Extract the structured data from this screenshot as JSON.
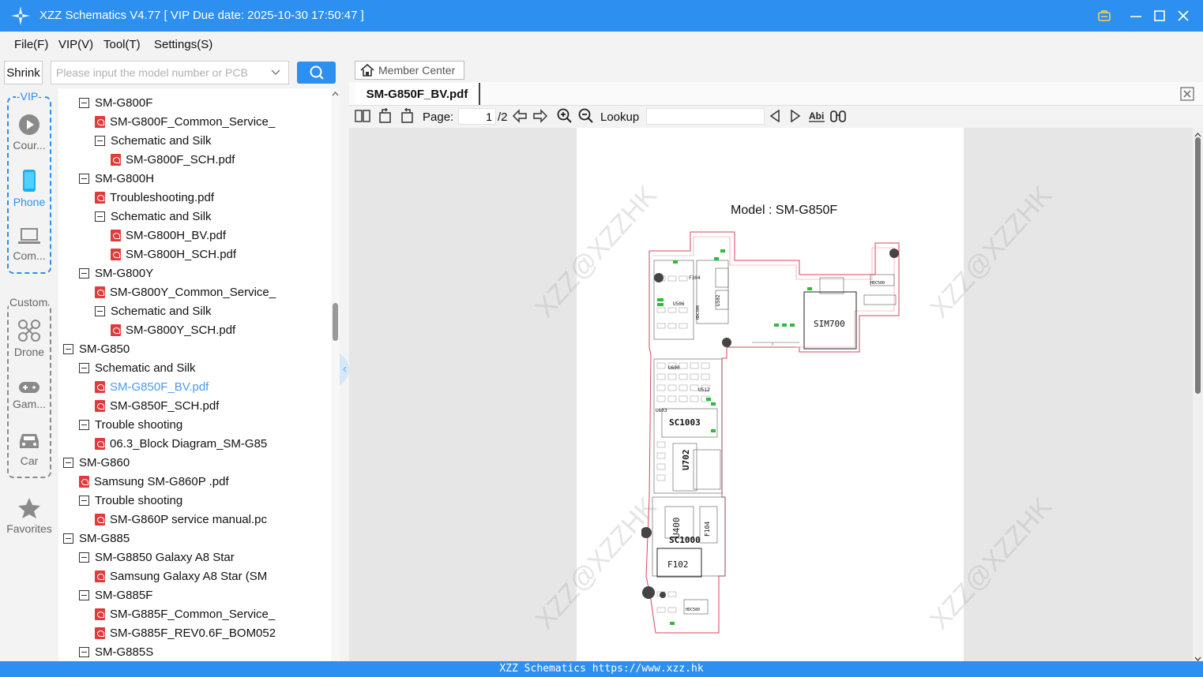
{
  "window": {
    "title": "XZZ Schematics V4.77 [ VIP Due date: 2025-10-30 17:50:47 ]"
  },
  "menu": [
    "File(F)",
    "VIP(V)",
    "Tool(T)",
    "Settings(S)"
  ],
  "search": {
    "shrink_label": "Shrink",
    "placeholder": "Please input the model number or PCB"
  },
  "rail": {
    "vip_label": "-VIP-",
    "vip_items": [
      {
        "label": "Cour...",
        "icon": "play-icon"
      },
      {
        "label": "Phone",
        "icon": "phone-icon"
      },
      {
        "label": "Com...",
        "icon": "laptop-icon"
      }
    ],
    "custom_label": "Custom",
    "custom_items": [
      {
        "label": "Drone",
        "icon": "drone-icon"
      },
      {
        "label": "Gam...",
        "icon": "gamepad-icon"
      },
      {
        "label": "Car",
        "icon": "car-icon"
      }
    ],
    "favorites_label": "Favorites"
  },
  "tree": [
    {
      "label": "SM-G800F",
      "type": "folder",
      "level": 2
    },
    {
      "label": "SM-G800F_Common_Service_",
      "type": "pdf",
      "level": 3
    },
    {
      "label": "Schematic and Silk",
      "type": "folder",
      "level": 3
    },
    {
      "label": "SM-G800F_SCH.pdf",
      "type": "pdf",
      "level": 4
    },
    {
      "label": "SM-G800H",
      "type": "folder",
      "level": 2
    },
    {
      "label": "Troubleshooting.pdf",
      "type": "pdf",
      "level": 3
    },
    {
      "label": "Schematic and Silk",
      "type": "folder",
      "level": 3
    },
    {
      "label": "SM-G800H_BV.pdf",
      "type": "pdf",
      "level": 4
    },
    {
      "label": "SM-G800H_SCH.pdf",
      "type": "pdf",
      "level": 4
    },
    {
      "label": "SM-G800Y",
      "type": "folder",
      "level": 2
    },
    {
      "label": "SM-G800Y_Common_Service_",
      "type": "pdf",
      "level": 3
    },
    {
      "label": "Schematic and Silk",
      "type": "folder",
      "level": 3
    },
    {
      "label": "SM-G800Y_SCH.pdf",
      "type": "pdf",
      "level": 4
    },
    {
      "label": "SM-G850",
      "type": "folder",
      "level": 1
    },
    {
      "label": "Schematic and Silk",
      "type": "folder",
      "level": 2
    },
    {
      "label": "SM-G850F_BV.pdf",
      "type": "pdf",
      "level": 3,
      "selected": true
    },
    {
      "label": "SM-G850F_SCH.pdf",
      "type": "pdf",
      "level": 3
    },
    {
      "label": "Trouble shooting",
      "type": "folder",
      "level": 2
    },
    {
      "label": "06.3_Block Diagram_SM-G85",
      "type": "pdf",
      "level": 3
    },
    {
      "label": "SM-G860",
      "type": "folder",
      "level": 1
    },
    {
      "label": "Samsung SM-G860P .pdf",
      "type": "pdf",
      "level": 2
    },
    {
      "label": "Trouble shooting",
      "type": "folder",
      "level": 2
    },
    {
      "label": "SM-G860P service manual.pc",
      "type": "pdf",
      "level": 3
    },
    {
      "label": "SM-G885",
      "type": "folder",
      "level": 1
    },
    {
      "label": "SM-G8850 Galaxy A8 Star",
      "type": "folder",
      "level": 2
    },
    {
      "label": "Samsung Galaxy A8 Star (SM",
      "type": "pdf",
      "level": 3
    },
    {
      "label": "SM-G885F",
      "type": "folder",
      "level": 2
    },
    {
      "label": "SM-G885F_Common_Service_",
      "type": "pdf",
      "level": 3
    },
    {
      "label": "SM-G885F_REV0.6F_BOM052",
      "type": "pdf",
      "level": 3
    },
    {
      "label": "SM-G885S",
      "type": "folder",
      "level": 2
    }
  ],
  "viewer": {
    "member_center": "Member Center",
    "tab_title": "SM-G850F_BV.pdf",
    "page_label": "Page:",
    "page_current": "1",
    "page_total": "/2",
    "lookup_label": "Lookup",
    "lookup_value": "",
    "doc": {
      "heading": "Model : SM-G850F",
      "watermark": "XZZ@XZZHK",
      "components": [
        "SIM700",
        "SC1003",
        "U702",
        "SC1000",
        "F102",
        "U400",
        "F104",
        "U506",
        "U502",
        "U512",
        "U600",
        "U603",
        "F304",
        "HDC500",
        "HDC300",
        "HDC580"
      ]
    }
  },
  "status": {
    "text": "XZZ Schematics https://www.xzz.hk"
  }
}
